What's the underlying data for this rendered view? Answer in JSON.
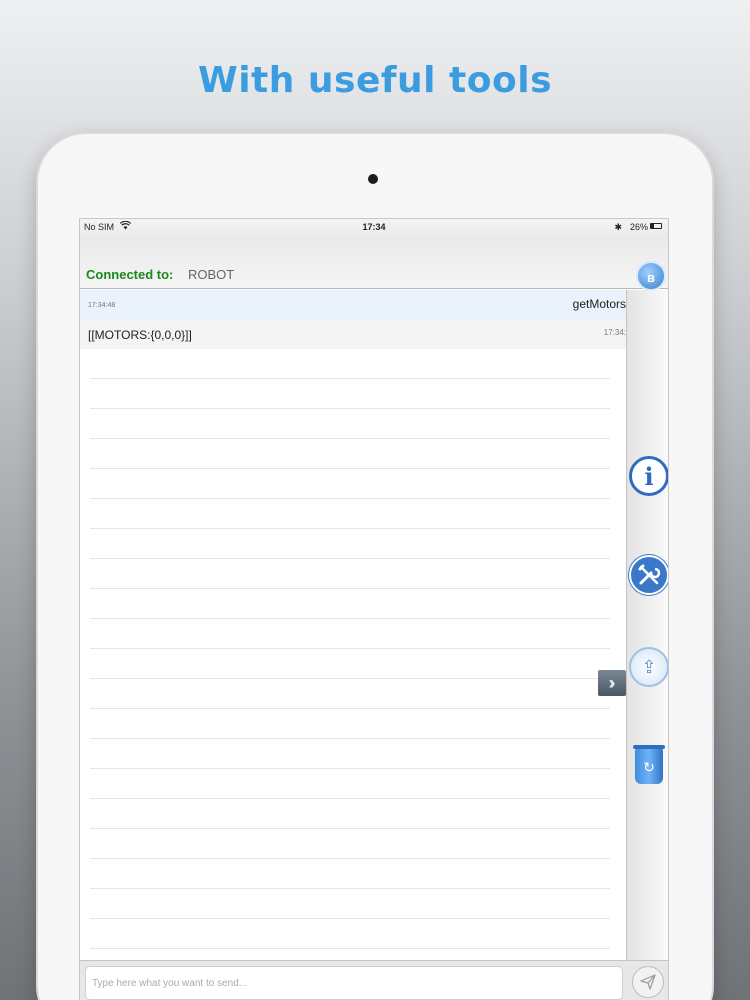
{
  "headline": "With useful tools",
  "status_bar": {
    "carrier": "No SIM",
    "wifi_icon": "wifi-icon",
    "time": "17:34",
    "bluetooth_icon": "bluetooth-icon",
    "battery": "26%"
  },
  "connection": {
    "label": "Connected to:",
    "device": "ROBOT",
    "badge_icon": "bluetooth-badge-icon"
  },
  "messages": [
    {
      "direction": "sent",
      "time": "17:34:48",
      "text": "getMotors"
    },
    {
      "direction": "received",
      "text": "[[MOTORS:{0,0,0}]]",
      "time": "17:34:"
    }
  ],
  "tools": {
    "info_icon": "info-icon",
    "tools_icon": "tools-icon",
    "share_icon": "share-icon",
    "trash_icon": "trash-icon",
    "expand_icon": "double-chevron-right-icon"
  },
  "input": {
    "value": "",
    "placeholder": "Type here what you want to send...",
    "send_icon": "send-icon"
  },
  "colors": {
    "headline": "#3b9de0",
    "connected": "#1a8a1a",
    "accent_blue": "#2f6bc2"
  }
}
